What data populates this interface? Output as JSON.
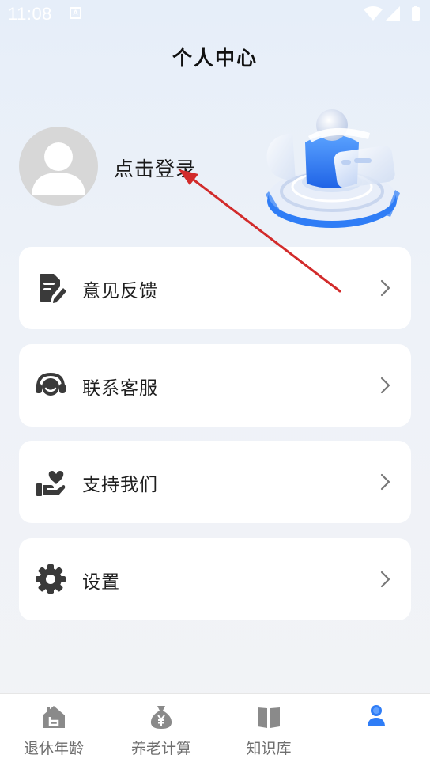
{
  "status_bar": {
    "time": "11:08",
    "notification_badge": "A"
  },
  "header": {
    "title": "个人中心"
  },
  "profile": {
    "login_prompt": "点击登录"
  },
  "menu": [
    {
      "label": "意见反馈",
      "icon": "feedback-document-icon"
    },
    {
      "label": "联系客服",
      "icon": "headset-icon"
    },
    {
      "label": "支持我们",
      "icon": "heart-in-hand-icon"
    },
    {
      "label": "设置",
      "icon": "gear-icon"
    }
  ],
  "tabs": [
    {
      "label": "退休年龄",
      "icon": "house-icon"
    },
    {
      "label": "养老计算",
      "icon": "money-bag-icon"
    },
    {
      "label": "知识库",
      "icon": "open-book-icon"
    },
    {
      "label": "",
      "icon": "person-icon",
      "active": true
    }
  ],
  "colors": {
    "accent": "#2f7df6",
    "arrow_annotation": "#d22b2b",
    "tab_icon_inactive": "#8a8a8a"
  }
}
